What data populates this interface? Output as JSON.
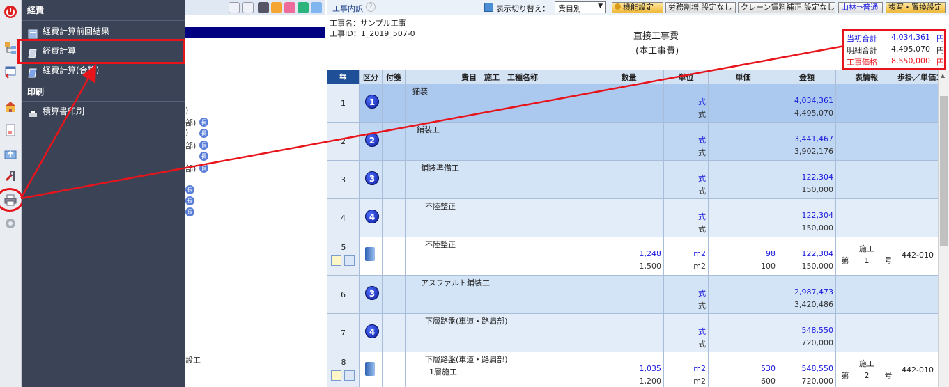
{
  "menu": {
    "section_expenses": "経費",
    "items_expenses": [
      "経費計算前回結果",
      "経費計算",
      "経費計算(合算)"
    ],
    "section_print": "印刷",
    "items_print": [
      "積算書印刷"
    ]
  },
  "middle_panel": {
    "fragments": [
      ")",
      "部)",
      ")",
      "部)",
      "部)",
      "設工"
    ],
    "badge_char": "長"
  },
  "right_header": {
    "title": "工事内訳",
    "display_switch_label": "表示切り替え：",
    "display_select_value": "費目別",
    "buttons": [
      "機能設定",
      "労務割増 設定なし",
      "クレーン賃料補正 設定なし",
      "山林⇒普通",
      "複写・置換設定"
    ]
  },
  "info": {
    "project_name": "工事名：サンプル工事",
    "project_id": "工事ID：1_2019_507-0",
    "center_title": "直接工事費",
    "center_subtitle": "(本工事費)",
    "totals": [
      {
        "label": "当初合計",
        "value": "4,034,361",
        "unit": "円",
        "color": "#1a1adc"
      },
      {
        "label": "明細合計",
        "value": "4,495,070",
        "unit": "円",
        "color": "#222222"
      },
      {
        "label": "工事価格",
        "value": "8,550,000",
        "unit": "円",
        "color": "#e8141c"
      }
    ]
  },
  "table": {
    "headers": [
      "",
      "区分",
      "付箋",
      "費目　施工　工種名称",
      "数量",
      "単位",
      "単価",
      "金額",
      "表情報",
      "歩掛／単価コー"
    ],
    "rows": [
      {
        "no": "1",
        "level": 1,
        "badge": "1",
        "name1": "鋪装",
        "name2": "",
        "indent": 10,
        "qty1": "",
        "qty2": "",
        "unit1": "式",
        "unit2": "式",
        "price1": "",
        "price2": "",
        "amt1": "4,034,361",
        "amt2": "4,495,070",
        "hyo1": "",
        "hyo2": "",
        "code": ""
      },
      {
        "no": "2",
        "level": 2,
        "badge": "2",
        "name1": "鋪装工",
        "name2": "",
        "indent": 16,
        "qty1": "",
        "qty2": "",
        "unit1": "式",
        "unit2": "式",
        "price1": "",
        "price2": "",
        "amt1": "3,441,467",
        "amt2": "3,902,176",
        "hyo1": "",
        "hyo2": "",
        "code": ""
      },
      {
        "no": "3",
        "level": 3,
        "badge": "3",
        "name1": "鋪装準備工",
        "name2": "",
        "indent": 22,
        "qty1": "",
        "qty2": "",
        "unit1": "式",
        "unit2": "式",
        "price1": "",
        "price2": "",
        "amt1": "122,304",
        "amt2": "150,000",
        "hyo1": "",
        "hyo2": "",
        "code": ""
      },
      {
        "no": "4",
        "level": 4,
        "badge": "4",
        "name1": "不陸整正",
        "name2": "",
        "indent": 28,
        "qty1": "",
        "qty2": "",
        "unit1": "式",
        "unit2": "式",
        "price1": "",
        "price2": "",
        "amt1": "122,304",
        "amt2": "150,000",
        "hyo1": "",
        "hyo2": "",
        "code": ""
      },
      {
        "no": "5",
        "level": 5,
        "badge": "",
        "name1": "不陸整正",
        "name2": "",
        "indent": 28,
        "qty1": "1,248",
        "qty2": "1,500",
        "unit1": "m2",
        "unit2": "m2",
        "price1": "98",
        "price2": "100",
        "amt1": "122,304",
        "amt2": "150,000",
        "hyo1": "施工",
        "hyo2": "第　　1　　号",
        "code": "442-010"
      },
      {
        "no": "6",
        "level": 3,
        "badge": "3",
        "name1": "アスファルト鋪装工",
        "name2": "",
        "indent": 22,
        "qty1": "",
        "qty2": "",
        "unit1": "式",
        "unit2": "式",
        "price1": "",
        "price2": "",
        "amt1": "2,987,473",
        "amt2": "3,420,486",
        "hyo1": "",
        "hyo2": "",
        "code": ""
      },
      {
        "no": "7",
        "level": 4,
        "badge": "4",
        "name1": "下層路盤(車道・路肩部)",
        "name2": "",
        "indent": 28,
        "qty1": "",
        "qty2": "",
        "unit1": "式",
        "unit2": "式",
        "price1": "",
        "price2": "",
        "amt1": "548,550",
        "amt2": "720,000",
        "hyo1": "",
        "hyo2": "",
        "code": ""
      },
      {
        "no": "8",
        "level": 5,
        "badge": "",
        "name1": "下層路盤(車道・路肩部)",
        "name2": "1層施工",
        "indent": 28,
        "qty1": "1,035",
        "qty2": "1,200",
        "unit1": "m2",
        "unit2": "m2",
        "price1": "530",
        "price2": "600",
        "amt1": "548,550",
        "amt2": "720,000",
        "hyo1": "施工",
        "hyo2": "第　　2　　号",
        "code": "442-010"
      }
    ]
  },
  "colors": {
    "menu_bg": "#3b4456",
    "highlight_red": "#e8141c",
    "header_blue": "#d4e3f4",
    "badge_blue": "#0b1b9a"
  }
}
